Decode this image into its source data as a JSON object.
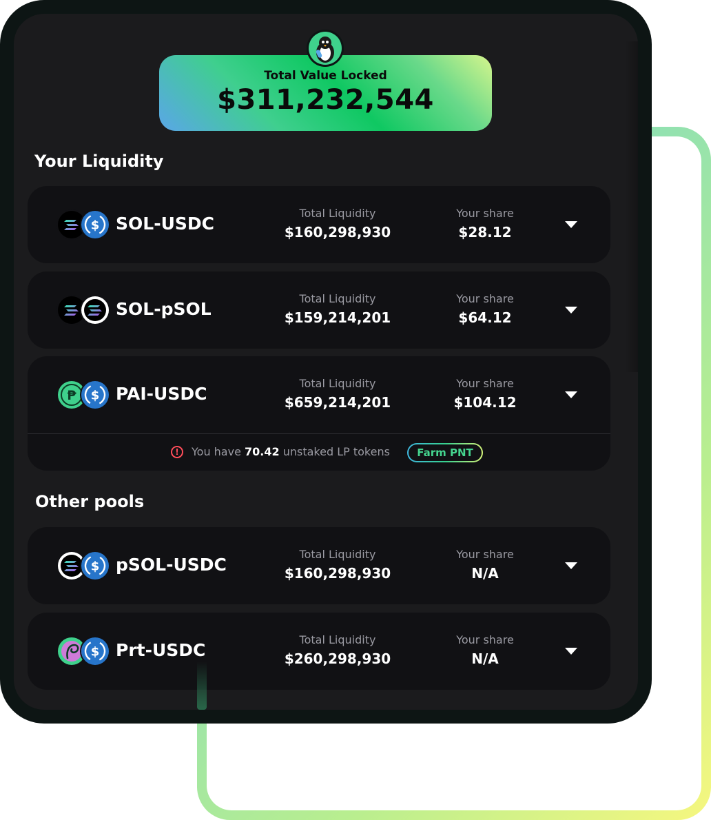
{
  "tvl": {
    "label": "Total Value Locked",
    "value": "$311,232,544"
  },
  "sections": {
    "your_liquidity": "Your Liquidity",
    "other_pools": "Other pools"
  },
  "labels": {
    "total_liquidity": "Total Liquidity",
    "your_share": "Your share"
  },
  "your_pools": [
    {
      "name": "SOL-USDC",
      "total_liquidity": "$160,298,930",
      "your_share": "$28.12",
      "icons": [
        "solana-icon",
        "usdc-icon"
      ]
    },
    {
      "name": "SOL-pSOL",
      "total_liquidity": "$159,214,201",
      "your_share": "$64.12",
      "icons": [
        "solana-icon",
        "psol-icon"
      ]
    },
    {
      "name": "PAI-USDC",
      "total_liquidity": "$659,214,201",
      "your_share": "$104.12",
      "icons": [
        "pai-icon",
        "usdc-icon"
      ]
    }
  ],
  "notice": {
    "prefix": "You have",
    "amount": "70.42",
    "suffix": "unstaked LP tokens",
    "button": "Farm PNT"
  },
  "other_pools": [
    {
      "name": "pSOL-USDC",
      "total_liquidity": "$160,298,930",
      "your_share": "N/A",
      "icons": [
        "psol-icon",
        "usdc-icon"
      ]
    },
    {
      "name": "Prt-USDC",
      "total_liquidity": "$260,298,930",
      "your_share": "N/A",
      "icons": [
        "prt-icon",
        "usdc-icon"
      ]
    }
  ],
  "colors": {
    "accent_green": "#45d690",
    "card_bg": "#111114",
    "screen_bg": "#1b1b1d",
    "warning": "#ff4d5a",
    "usdc_blue": "#2775ca"
  }
}
